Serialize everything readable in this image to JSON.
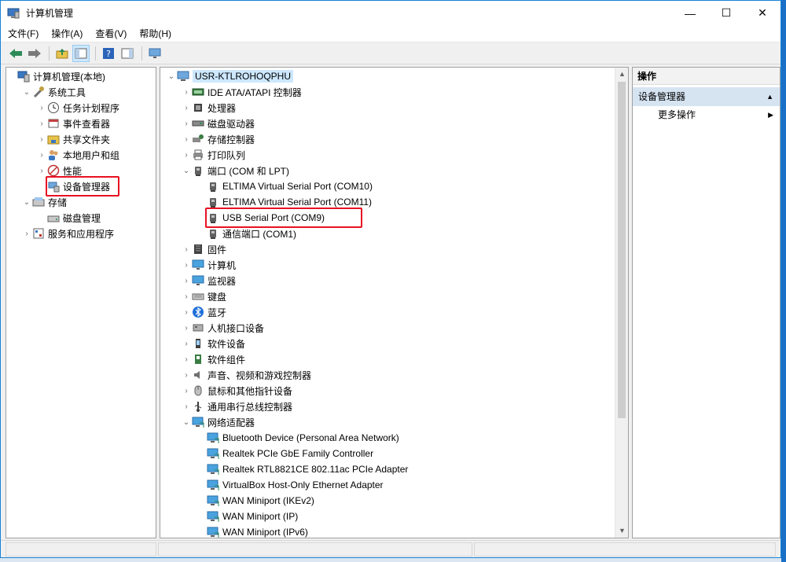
{
  "window": {
    "title": "计算机管理",
    "controls": {
      "minimize": "—",
      "maximize": "☐",
      "close": "✕"
    }
  },
  "menu": [
    "文件(F)",
    "操作(A)",
    "查看(V)",
    "帮助(H)"
  ],
  "left_tree": [
    {
      "label": "计算机管理(本地)",
      "icon": "computer-management-icon",
      "arrow": "",
      "depth": 0
    },
    {
      "label": "系统工具",
      "icon": "tools-icon",
      "arrow": "⌄",
      "depth": 1
    },
    {
      "label": "任务计划程序",
      "icon": "clock-icon",
      "arrow": "›",
      "depth": 2
    },
    {
      "label": "事件查看器",
      "icon": "event-viewer-icon",
      "arrow": "›",
      "depth": 2
    },
    {
      "label": "共享文件夹",
      "icon": "shared-folder-icon",
      "arrow": "›",
      "depth": 2
    },
    {
      "label": "本地用户和组",
      "icon": "users-icon",
      "arrow": "›",
      "depth": 2
    },
    {
      "label": "性能",
      "icon": "performance-icon",
      "arrow": "›",
      "depth": 2
    },
    {
      "label": "设备管理器",
      "icon": "device-manager-icon",
      "arrow": "",
      "depth": 2
    },
    {
      "label": "存储",
      "icon": "storage-icon",
      "arrow": "⌄",
      "depth": 1
    },
    {
      "label": "磁盘管理",
      "icon": "disk-management-icon",
      "arrow": "",
      "depth": 2
    },
    {
      "label": "服务和应用程序",
      "icon": "services-icon",
      "arrow": "›",
      "depth": 1
    }
  ],
  "device_tree": [
    {
      "label": "USR-KTLROHOQPHU",
      "icon": "computer-icon",
      "arrow": "⌄",
      "depth": 0
    },
    {
      "label": "IDE ATA/ATAPI 控制器",
      "icon": "ide-icon",
      "arrow": "›",
      "depth": 1
    },
    {
      "label": "处理器",
      "icon": "cpu-icon",
      "arrow": "›",
      "depth": 1
    },
    {
      "label": "磁盘驱动器",
      "icon": "disk-icon",
      "arrow": "›",
      "depth": 1
    },
    {
      "label": "存储控制器",
      "icon": "storage-controller-icon",
      "arrow": "›",
      "depth": 1
    },
    {
      "label": "打印队列",
      "icon": "printer-icon",
      "arrow": "›",
      "depth": 1
    },
    {
      "label": "端口 (COM 和 LPT)",
      "icon": "port-icon",
      "arrow": "⌄",
      "depth": 1
    },
    {
      "label": "ELTIMA Virtual Serial Port (COM10)",
      "icon": "port-icon",
      "arrow": "",
      "depth": 2
    },
    {
      "label": "ELTIMA Virtual Serial Port (COM11)",
      "icon": "port-icon",
      "arrow": "",
      "depth": 2
    },
    {
      "label": "USB Serial Port (COM9)",
      "icon": "port-icon",
      "arrow": "",
      "depth": 2
    },
    {
      "label": "通信端口 (COM1)",
      "icon": "port-icon",
      "arrow": "",
      "depth": 2
    },
    {
      "label": "固件",
      "icon": "firmware-icon",
      "arrow": "›",
      "depth": 1
    },
    {
      "label": "计算机",
      "icon": "monitor-icon",
      "arrow": "›",
      "depth": 1
    },
    {
      "label": "监视器",
      "icon": "monitor-icon",
      "arrow": "›",
      "depth": 1
    },
    {
      "label": "键盘",
      "icon": "keyboard-icon",
      "arrow": "›",
      "depth": 1
    },
    {
      "label": "蓝牙",
      "icon": "bluetooth-icon",
      "arrow": "›",
      "depth": 1
    },
    {
      "label": "人机接口设备",
      "icon": "hid-icon",
      "arrow": "›",
      "depth": 1
    },
    {
      "label": "软件设备",
      "icon": "software-device-icon",
      "arrow": "›",
      "depth": 1
    },
    {
      "label": "软件组件",
      "icon": "software-component-icon",
      "arrow": "›",
      "depth": 1
    },
    {
      "label": "声音、视频和游戏控制器",
      "icon": "speaker-icon",
      "arrow": "›",
      "depth": 1
    },
    {
      "label": "鼠标和其他指针设备",
      "icon": "mouse-icon",
      "arrow": "›",
      "depth": 1
    },
    {
      "label": "通用串行总线控制器",
      "icon": "usb-icon",
      "arrow": "›",
      "depth": 1
    },
    {
      "label": "网络适配器",
      "icon": "network-icon",
      "arrow": "⌄",
      "depth": 1
    },
    {
      "label": "Bluetooth Device (Personal Area Network)",
      "icon": "network-icon",
      "arrow": "",
      "depth": 2
    },
    {
      "label": "Realtek PCIe GbE Family Controller",
      "icon": "network-icon",
      "arrow": "",
      "depth": 2
    },
    {
      "label": "Realtek RTL8821CE 802.11ac PCIe Adapter",
      "icon": "network-icon",
      "arrow": "",
      "depth": 2
    },
    {
      "label": "VirtualBox Host-Only Ethernet Adapter",
      "icon": "network-icon",
      "arrow": "",
      "depth": 2
    },
    {
      "label": "WAN Miniport (IKEv2)",
      "icon": "network-icon",
      "arrow": "",
      "depth": 2
    },
    {
      "label": "WAN Miniport (IP)",
      "icon": "network-icon",
      "arrow": "",
      "depth": 2
    },
    {
      "label": "WAN Miniport (IPv6)",
      "icon": "network-icon",
      "arrow": "",
      "depth": 2
    }
  ],
  "actions": {
    "header": "操作",
    "section": "设备管理器",
    "items": [
      "更多操作"
    ]
  },
  "colors": {
    "highlight_box": "#e81123",
    "section_bg": "#d6e4f2",
    "window_border": "#1883d7"
  }
}
